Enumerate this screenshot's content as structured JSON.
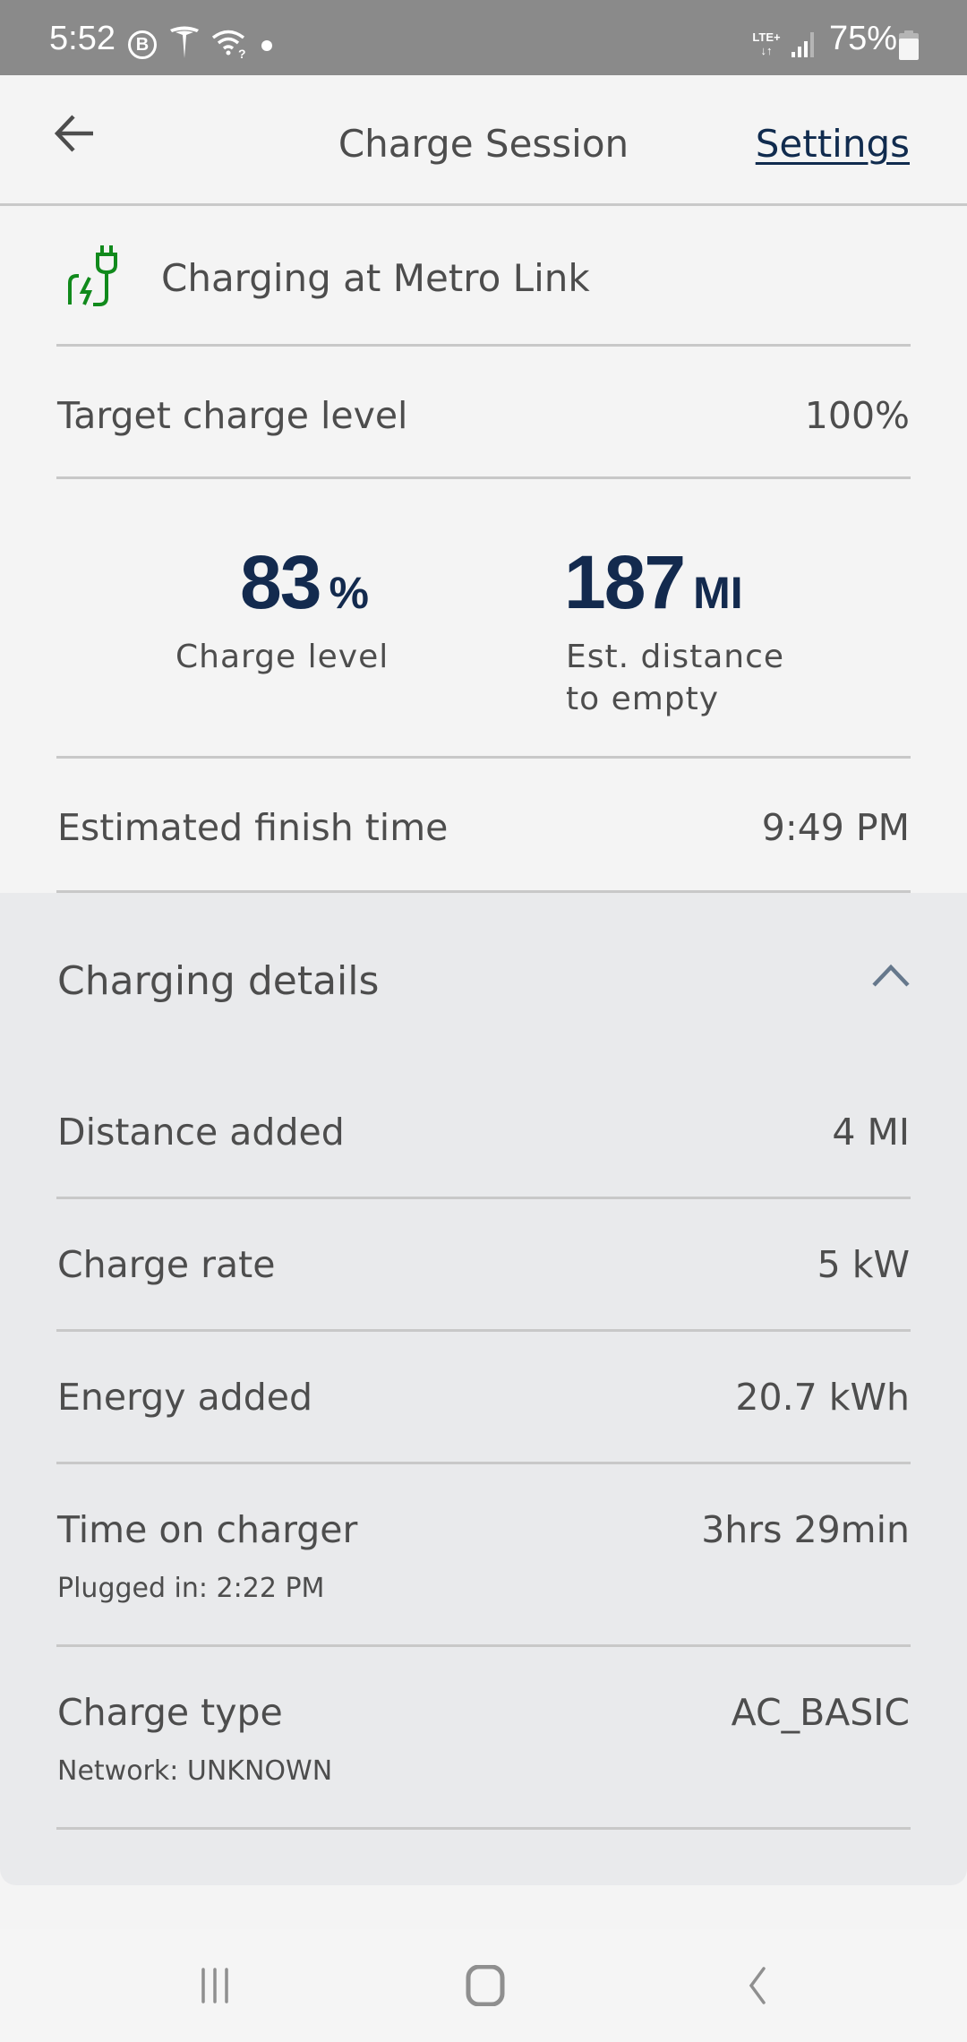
{
  "status_bar": {
    "time": "5:52",
    "left_icons": [
      "b-circle-icon",
      "tesla-icon",
      "wifi-question-icon",
      "notification-dot-icon"
    ],
    "network_type": "LTE+",
    "battery_percent": "75%"
  },
  "header": {
    "title": "Charge Session",
    "settings_label": "Settings",
    "back_icon": "arrow-left-icon"
  },
  "location": {
    "icon": "ev-plug-icon",
    "text": "Charging at Metro Link",
    "icon_color": "#118a1c"
  },
  "target": {
    "label": "Target charge level",
    "value": "100%"
  },
  "stats": {
    "charge_level": {
      "value": "83",
      "unit": "%",
      "label": "Charge level"
    },
    "distance": {
      "value": "187",
      "unit": "MI",
      "label_line1": "Est. distance",
      "label_line2": "to empty"
    }
  },
  "finish": {
    "label": "Estimated finish time",
    "value": "9:49 PM"
  },
  "details": {
    "title": "Charging details",
    "expanded": true,
    "rows": [
      {
        "label": "Distance added",
        "value": "4 MI"
      },
      {
        "label": "Charge rate",
        "value": "5 kW"
      },
      {
        "label": "Energy added",
        "value": "20.7 kWh"
      },
      {
        "label": "Time on charger",
        "value": "3hrs 29min",
        "sub": "Plugged in: 2:22 PM"
      },
      {
        "label": "Charge type",
        "value": "AC_BASIC",
        "sub": "Network: UNKNOWN"
      }
    ]
  },
  "colors": {
    "accent_navy": "#132a4e",
    "plug_green": "#118a1c",
    "panel_bg": "#e9eaec",
    "page_bg": "#f4f4f4"
  },
  "nav_bar": {
    "buttons": [
      "recent-apps",
      "home",
      "back"
    ]
  }
}
